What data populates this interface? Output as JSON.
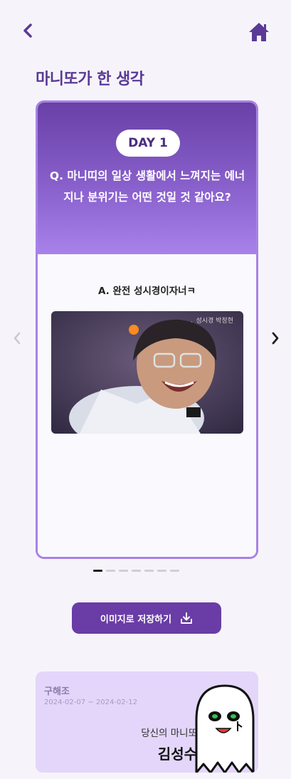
{
  "header": {
    "back_icon": "chevron-left-icon",
    "home_icon": "home-icon"
  },
  "page_title": "마니또가 한 생각",
  "card": {
    "day_label": "DAY 1",
    "question": "Q. 마니띠의 일상 생활에서 느껴지는 에너지나 분위기는 어떤 것일 것 같아요?",
    "answer": "A. 완전 성시경이자너ㅋ",
    "photo_caption": "성시경 박정현"
  },
  "carousel": {
    "prev_icon": "chevron-left-icon",
    "next_icon": "chevron-right-icon",
    "page_count": 7,
    "active_index": 0
  },
  "save_button": {
    "label": "이미지로 저장하기",
    "icon": "download-icon"
  },
  "info": {
    "group_name": "구해조",
    "date_range": "2024-02-07 ~ 2024-02-12",
    "manitto_label": "당신의 마니또",
    "manitto_name": "김성수"
  },
  "colors": {
    "accent": "#5a3a96",
    "button": "#6a3ca6",
    "card_border": "#a783e6",
    "info_bg": "#e3d6fa"
  }
}
